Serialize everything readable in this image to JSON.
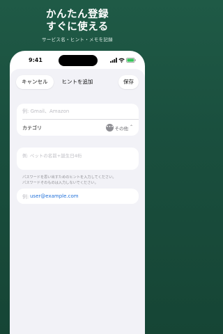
{
  "promo": {
    "title_line1": "かんたん登録",
    "title_line2": "すぐに使える",
    "subtitle": "サービス名・ヒント・メモを記録"
  },
  "status_bar": {
    "time": "9:41",
    "icons": [
      "signal-icon",
      "wifi-icon",
      "battery-icon"
    ]
  },
  "nav": {
    "cancel_label": "キャンセル",
    "title": "ヒントを追加",
    "save_label": "保存"
  },
  "form": {
    "service_placeholder": "例: Gmail、Amazon",
    "category_label": "カテゴリ",
    "category_value": "その他",
    "category_icon": "more-icon",
    "hint_placeholder": "例: ペットの名前+誕生日4桁",
    "footnote_line1": "パスワードを思い出すためのヒントを入力してください。",
    "footnote_line2": "パスワードそのものは入力しないでください。",
    "email_prefix": "例:",
    "email_value": "user@example.com"
  },
  "colors": {
    "background": "#1f5a46",
    "link": "#1e6fd9",
    "sheet": "#f2f2f7"
  }
}
